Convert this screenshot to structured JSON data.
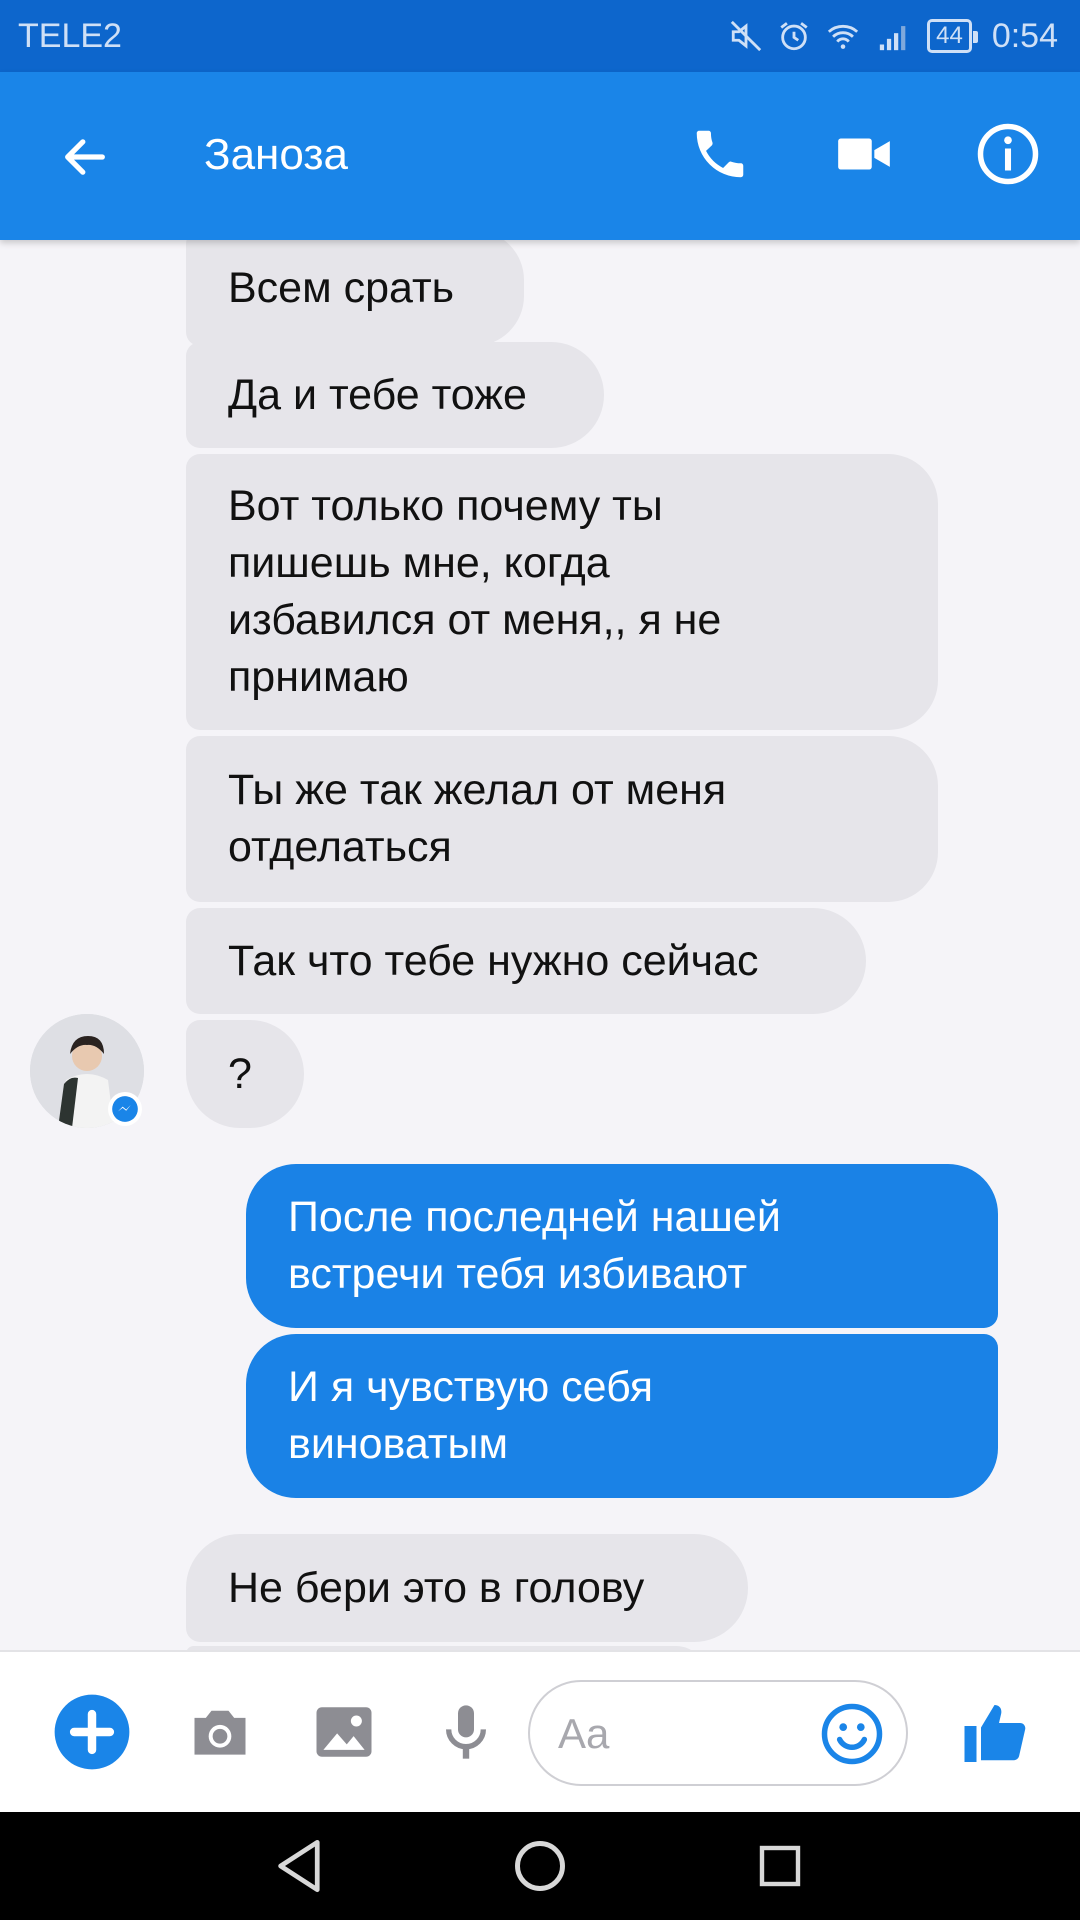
{
  "status_bar": {
    "carrier": "TELE2",
    "battery": "44",
    "time": "0:54"
  },
  "header": {
    "title": "Заноза"
  },
  "messages": [
    {
      "side": "in",
      "text": "Всем срать"
    },
    {
      "side": "in",
      "text": "Да и тебе тоже"
    },
    {
      "side": "in",
      "lines": [
        "Вот только почему ты",
        "пишешь мне, когда",
        "избавился от меня,, я не",
        "прнимаю"
      ]
    },
    {
      "side": "in",
      "lines": [
        "Ты же так желал от меня",
        "отделаться"
      ]
    },
    {
      "side": "in",
      "text": "Так что тебе нужно сейчас"
    },
    {
      "side": "in",
      "text": "?"
    },
    {
      "side": "out",
      "lines": [
        "После последней нашей",
        "встречи тебя избивают"
      ]
    },
    {
      "side": "out",
      "lines": [
        "И я чувствую себя",
        "виноватым"
      ]
    },
    {
      "side": "in",
      "text": "Не бери  это в голову"
    }
  ],
  "composer": {
    "placeholder": "Aa"
  },
  "colors": {
    "brand": "#1a85e8",
    "status_bar": "#0d66cc",
    "incoming_bubble": "#e6e5ea",
    "outgoing_bubble": "#1a82e6"
  },
  "icons": [
    "back-arrow-icon",
    "phone-icon",
    "video-camera-icon",
    "info-icon",
    "plus-icon",
    "camera-icon",
    "image-icon",
    "microphone-icon",
    "emoji-icon",
    "thumbs-up-icon",
    "nav-back-icon",
    "nav-home-icon",
    "nav-recents-icon"
  ]
}
